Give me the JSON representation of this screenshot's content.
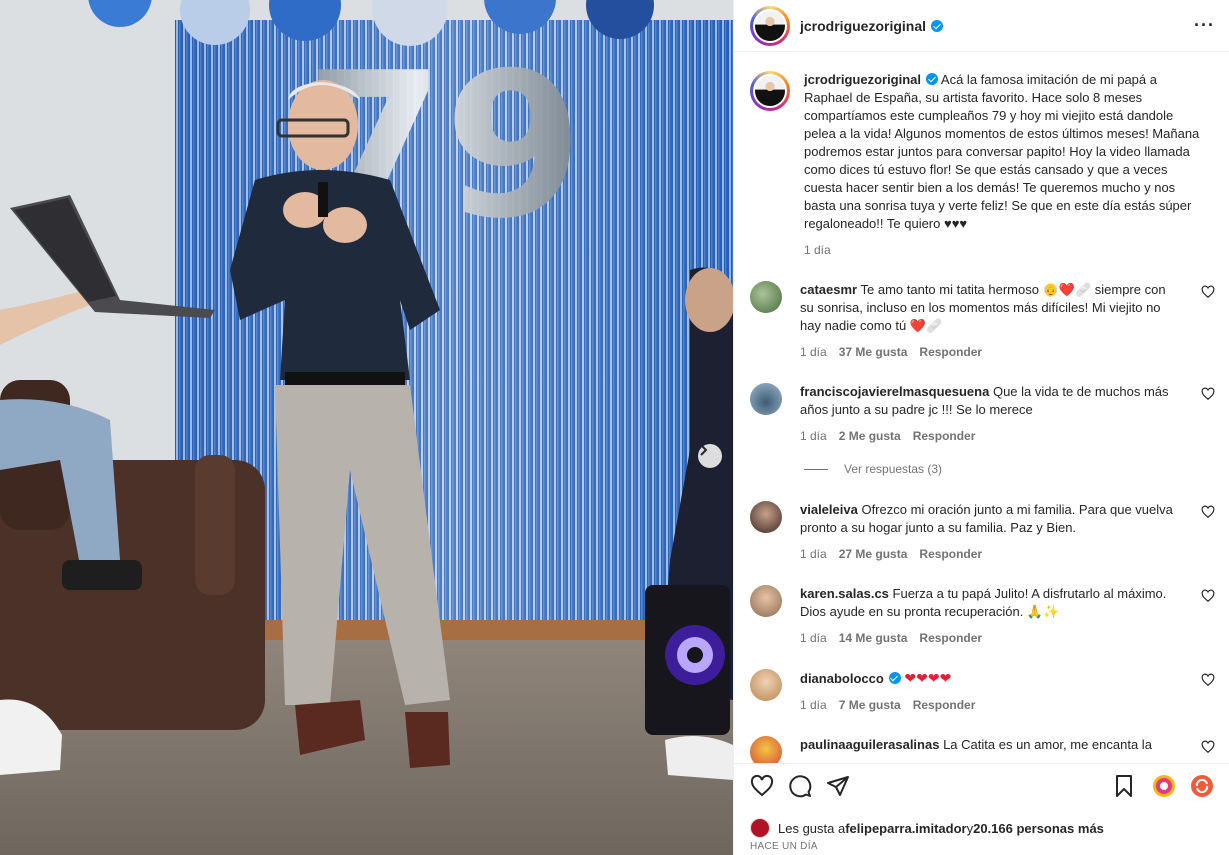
{
  "post": {
    "author": "jcrodriguezoriginal",
    "caption": "Acá la famosa imitación de mi papá a Raphael de España, su artista favorito. Hace solo 8 meses compartíamos este cumpleaños 79 y hoy mi viejito está dandole pelea a la vida! Algunos momentos de estos últimos meses! Mañana podremos estar juntos para conversar papito! Hoy la video llamada como dices tú estuvo flor! Se que estás cansado y que a veces cuesta hacer sentir bien a los demás! Te queremos mucho y nos basta una sonrisa tuya y verte feliz! Se que en este día estás súper regaloneado!! Te quiero ♥♥♥",
    "caption_time": "1 día",
    "balloon_number": "79"
  },
  "comments": [
    {
      "user": "cataesmr",
      "text": "Te amo tanto mi tatita hermoso 👴❤️🩹 siempre con su sonrisa, incluso en los momentos más difíciles! Mi viejito no hay nadie como tú ❤️🩹",
      "time": "1 día",
      "likes": "37 Me gusta",
      "reply": "Responder"
    },
    {
      "user": "franciscojavierelmasquesuena",
      "text": "Que la vida te de muchos más años junto a su padre jc !!! Se lo merece",
      "time": "1 día",
      "likes": "2 Me gusta",
      "reply": "Responder"
    },
    {
      "user": "vialeleiva",
      "text": "Ofrezco mi oración junto a mi familia. Para que vuelva pronto a su hogar junto a su familia. Paz y Bien.",
      "time": "1 día",
      "likes": "27 Me gusta",
      "reply": "Responder"
    },
    {
      "user": "karen.salas.cs",
      "text": "Fuerza a tu papá Julito! A disfrutarlo al máximo. Dios ayude en su pronta recuperación. 🙏✨",
      "time": "1 día",
      "likes": "14 Me gusta",
      "reply": "Responder"
    },
    {
      "user": "dianabolocco",
      "text": "",
      "hearts": "❤❤❤❤",
      "time": "1 día",
      "likes": "7 Me gusta",
      "reply": "Responder"
    },
    {
      "user": "paulinaaguilerasalinas",
      "text": "La Catita es un amor, me encanta la"
    }
  ],
  "view_replies": "Ver respuestas (3)",
  "likes_summary": {
    "prefix": "Les gusta a ",
    "liker": "felipeparra.imitador",
    "middle": " y ",
    "count": "20.166 personas más"
  },
  "post_date": "HACE UN DÍA",
  "icons": {
    "more": "more-horizontal-icon",
    "like": "heart-icon",
    "comment": "comment-icon",
    "share": "send-icon",
    "save": "bookmark-icon",
    "next": "chevron-right-icon"
  },
  "colors": {
    "verified": "#0095f6",
    "heart": "#ed1c36",
    "meta_text": "#737373",
    "curtain": "#1f5fb8"
  }
}
